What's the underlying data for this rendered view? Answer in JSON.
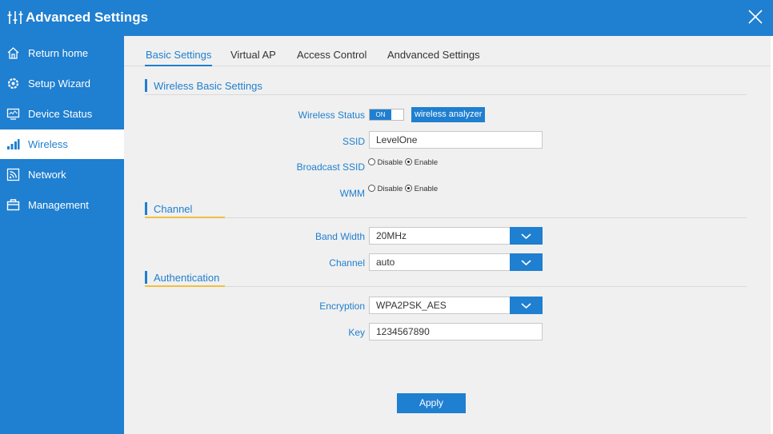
{
  "header": {
    "title": "Advanced Settings"
  },
  "sidebar": {
    "items": [
      {
        "label": "Return home",
        "icon": "home-icon"
      },
      {
        "label": "Setup Wizard",
        "icon": "gear-icon"
      },
      {
        "label": "Device Status",
        "icon": "monitor-icon"
      },
      {
        "label": "Wireless",
        "icon": "signal-bars-icon"
      },
      {
        "label": "Network",
        "icon": "network-icon"
      },
      {
        "label": "Management",
        "icon": "toolbox-icon"
      }
    ],
    "active_index": 3
  },
  "tabs": [
    {
      "label": "Basic Settings"
    },
    {
      "label": "Virtual AP"
    },
    {
      "label": "Access Control"
    },
    {
      "label": "Andvanced Settings"
    }
  ],
  "sections": {
    "wireless_basic": "Wireless Basic Settings",
    "channel": "Channel",
    "authentication": "Authentication"
  },
  "form": {
    "wireless_status_label": "Wireless Status",
    "toggle_on": "ON",
    "analyzer_button": "wireless analyzer",
    "ssid_label": "SSID",
    "ssid_value": "LevelOne",
    "broadcast_label": "Broadcast SSID",
    "wmm_label": "WMM",
    "disable": "Disable",
    "enable": "Enable",
    "bandwidth_label": "Band Width",
    "bandwidth_value": "20MHz",
    "channel_label": "Channel",
    "channel_value": "auto",
    "encryption_label": "Encryption",
    "encryption_value": "WPA2PSK_AES",
    "key_label": "Key",
    "key_value": "1234567890"
  },
  "apply_button": "Apply",
  "colors": {
    "accent": "#1f7fd0",
    "background": "#f0f0f0",
    "highlight": "#f0c040"
  }
}
